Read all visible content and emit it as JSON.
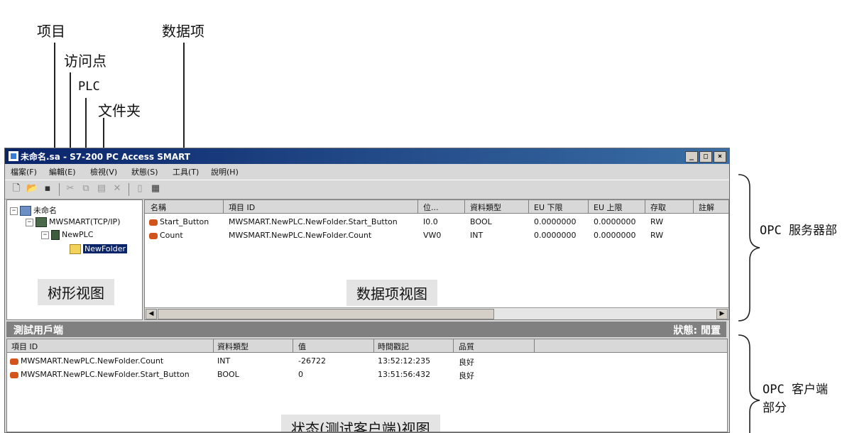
{
  "callouts": {
    "project": "项目",
    "access_point": "访问点",
    "plc": "PLC",
    "folder": "文件夹",
    "data_item": "数据项"
  },
  "window": {
    "title": "未命名.sa - S7-200 PC Access SMART",
    "buttons": {
      "minimize": "_",
      "maximize": "□",
      "close": "×"
    }
  },
  "menubar": [
    "檔案(F)",
    "編輯(E)",
    "檢視(V)",
    "狀態(S)",
    "工具(T)",
    "說明(H)"
  ],
  "tree": {
    "project": "未命名",
    "access_point": "MWSMART(TCP/IP)",
    "plc": "NewPLC",
    "folder": "NewFolder"
  },
  "grid": {
    "columns": [
      "名稱",
      "項目 ID",
      "位...",
      "資料類型",
      "EU 下限",
      "EU 上限",
      "存取",
      "註解"
    ],
    "rows": [
      {
        "name": "Start_Button",
        "item_id": "MWSMART.NewPLC.NewFolder.Start_Button",
        "address": "I0.0",
        "type": "BOOL",
        "eu_low": "0.0000000",
        "eu_high": "0.0000000",
        "access": "RW"
      },
      {
        "name": "Count",
        "item_id": "MWSMART.NewPLC.NewFolder.Count",
        "address": "VW0",
        "type": "INT",
        "eu_low": "0.0000000",
        "eu_high": "0.0000000",
        "access": "RW"
      }
    ]
  },
  "view_labels": {
    "tree": "树形视图",
    "data": "数据项视图",
    "status": "状态(测试客户端)视图"
  },
  "client": {
    "title": "測試用戶端",
    "status": "狀態: 閒置",
    "columns": [
      "項目 ID",
      "資料類型",
      "值",
      "時間戳記",
      "品質"
    ],
    "rows": [
      {
        "item_id": "MWSMART.NewPLC.NewFolder.Count",
        "type": "INT",
        "value": "-26722",
        "timestamp": "13:52:12:235",
        "quality": "良好"
      },
      {
        "item_id": "MWSMART.NewPLC.NewFolder.Start_Button",
        "type": "BOOL",
        "value": "0",
        "timestamp": "13:51:56:432",
        "quality": "良好"
      }
    ]
  },
  "side": {
    "server": "OPC 服务器部",
    "client_line1": "OPC 客户端",
    "client_line2": "部分"
  }
}
